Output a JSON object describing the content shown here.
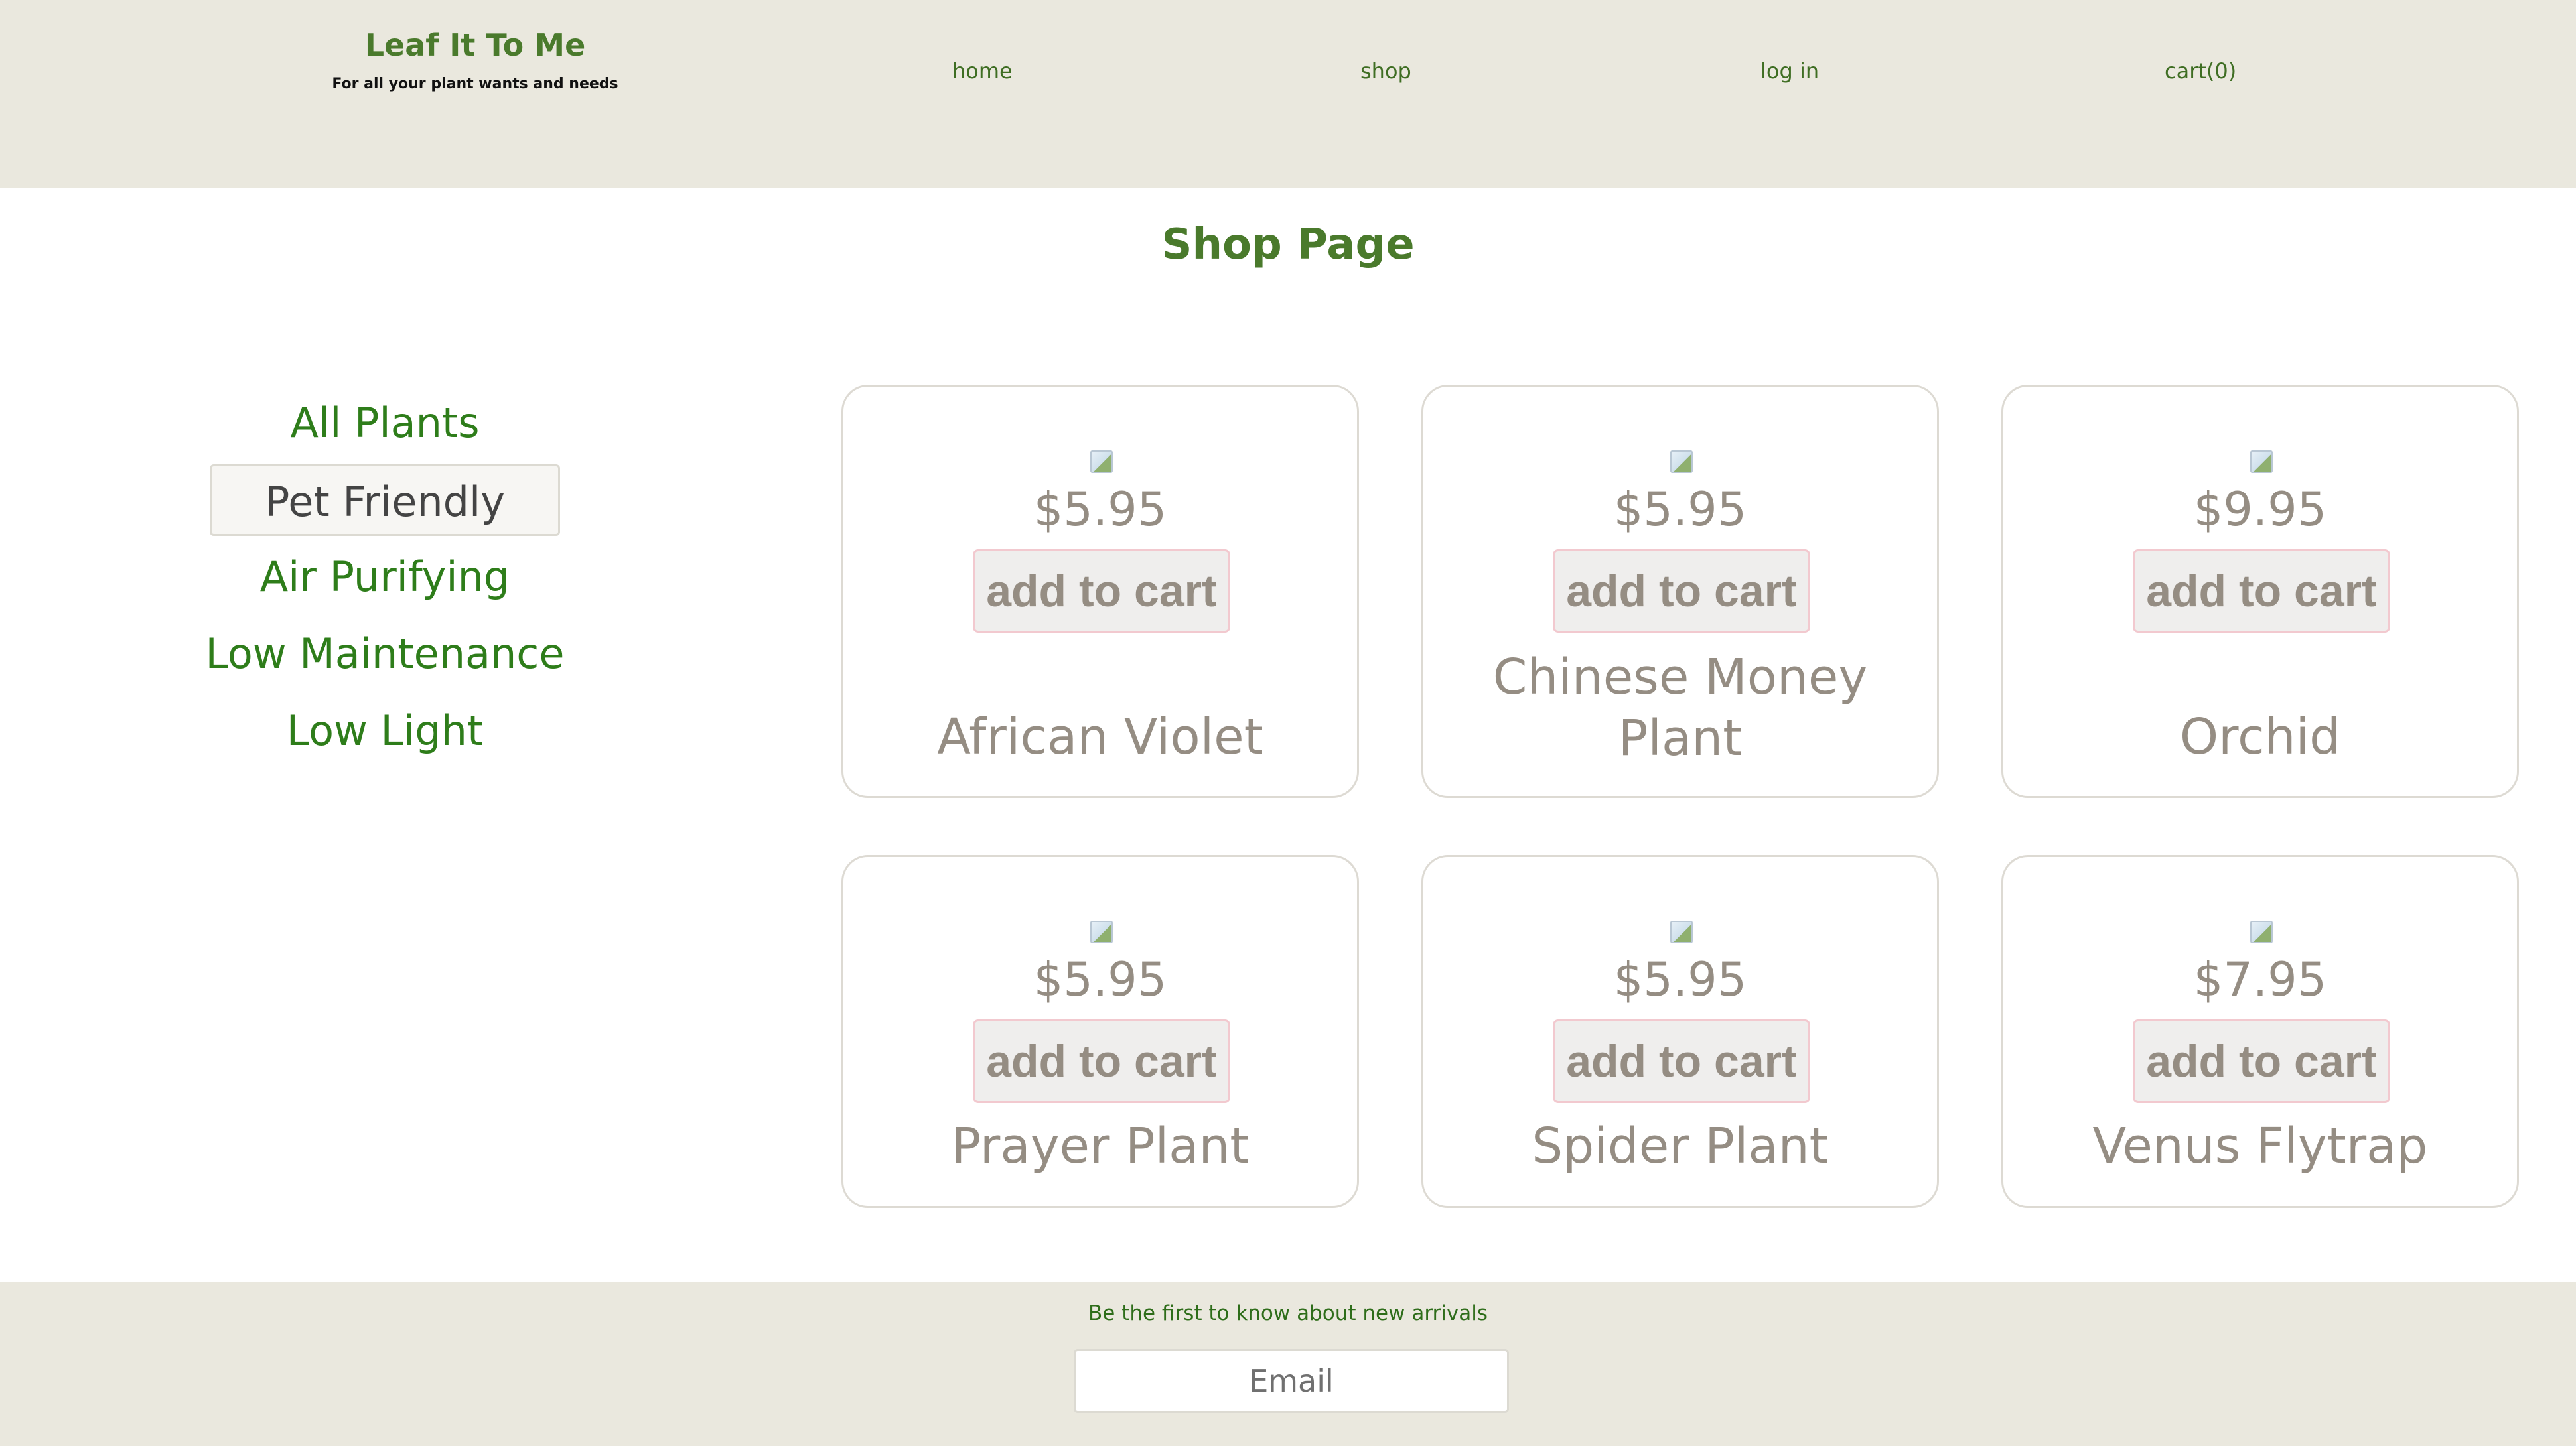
{
  "header": {
    "brand_title": "Leaf It To Me",
    "tagline": "For all your plant wants and needs",
    "nav": {
      "home": "home",
      "shop": "shop",
      "login": "log in",
      "cart": "cart(0)"
    }
  },
  "page": {
    "title": "Shop Page"
  },
  "sidebar": {
    "filters": [
      {
        "label": "All Plants"
      },
      {
        "label": "Pet Friendly",
        "active": true
      },
      {
        "label": "Air Purifying"
      },
      {
        "label": "Low Maintenance"
      },
      {
        "label": "Low Light"
      }
    ]
  },
  "products": [
    {
      "name": "African Violet",
      "price": "$5.95",
      "button": "add to cart"
    },
    {
      "name": "Chinese Money Plant",
      "price": "$5.95",
      "button": "add to cart"
    },
    {
      "name": "Orchid",
      "price": "$9.95",
      "button": "add to cart"
    },
    {
      "name": "Prayer Plant",
      "price": "$5.95",
      "button": "add to cart"
    },
    {
      "name": "Spider Plant",
      "price": "$5.95",
      "button": "add to cart"
    },
    {
      "name": "Venus Flytrap",
      "price": "$7.95",
      "button": "add to cart"
    }
  ],
  "footer": {
    "newsletter_text": "Be the first to know about new arrivals",
    "email_placeholder": "Email"
  },
  "colors": {
    "header_bg": "#eae8de",
    "brand_green": "#4a7a2c",
    "filter_green": "#2e7d1a",
    "muted_text": "#958d83",
    "button_border": "#f2c9cf"
  }
}
